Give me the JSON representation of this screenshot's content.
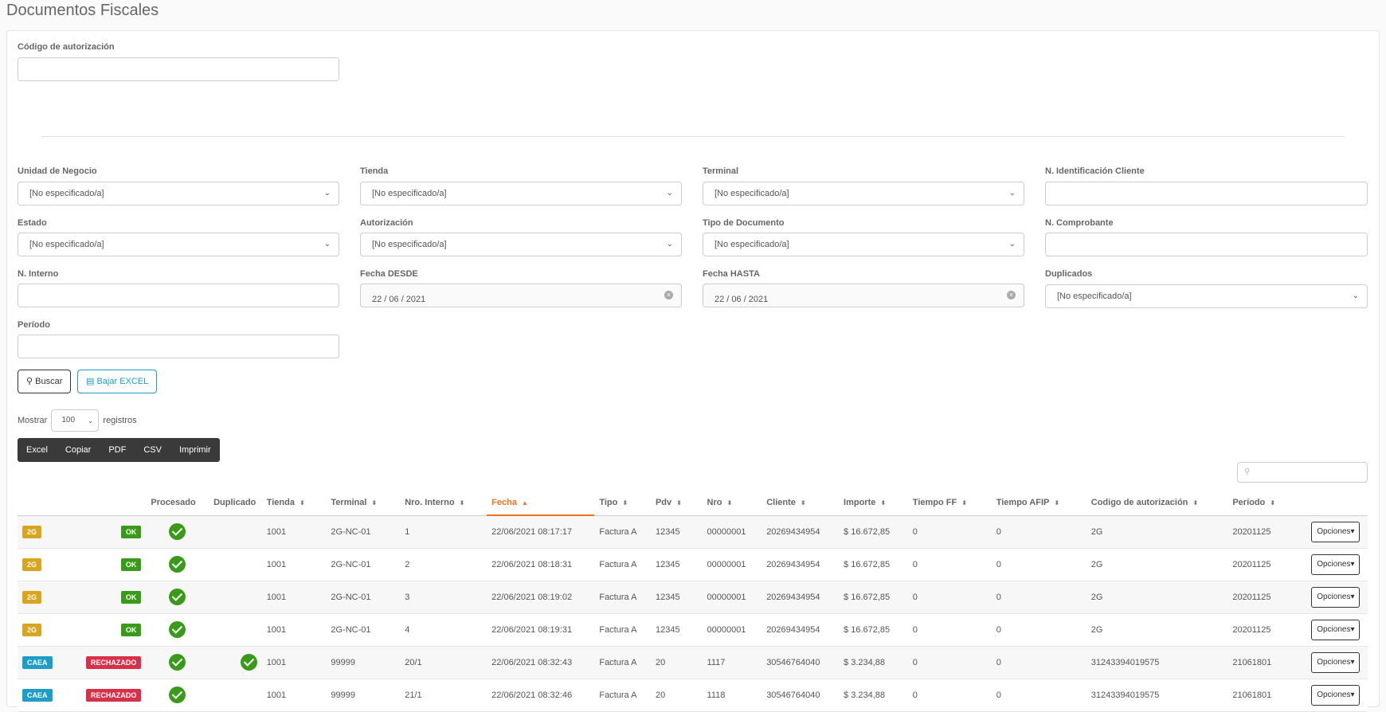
{
  "page": {
    "title": "Documentos Fiscales"
  },
  "filters": {
    "auth_code": {
      "label": "Código de autorización",
      "value": ""
    },
    "unidad": {
      "label": "Unidad de Negocio",
      "value": "[No especificado/a]"
    },
    "tienda": {
      "label": "Tienda",
      "value": "[No especificado/a]"
    },
    "terminal": {
      "label": "Terminal",
      "value": "[No especificado/a]"
    },
    "n_ident_cliente": {
      "label": "N. Identificación Cliente",
      "value": ""
    },
    "estado": {
      "label": "Estado",
      "value": "[No especificado/a]"
    },
    "autorizacion": {
      "label": "Autorización",
      "value": "[No especificado/a]"
    },
    "tipo_doc": {
      "label": "Tipo de Documento",
      "value": "[No especificado/a]"
    },
    "n_comprobante": {
      "label": "N. Comprobante",
      "value": ""
    },
    "n_interno": {
      "label": "N. Interno",
      "value": ""
    },
    "fecha_desde": {
      "label": "Fecha DESDE",
      "value": "22 / 06 / 2021"
    },
    "fecha_hasta": {
      "label": "Fecha HASTA",
      "value": "22 / 06 / 2021"
    },
    "duplicados": {
      "label": "Duplicados",
      "value": "[No especificado/a]"
    },
    "periodo": {
      "label": "Período",
      "value": ""
    }
  },
  "actions": {
    "search": "Buscar",
    "excel": "Bajar EXCEL"
  },
  "length_menu": {
    "prefix": "Mostrar",
    "value": "100",
    "suffix": "registros"
  },
  "export_buttons": [
    "Excel",
    "Copiar",
    "PDF",
    "CSV",
    "Imprimir"
  ],
  "colors": {
    "badge_2g": "#d9a520",
    "badge_caea": "#1e9dc8",
    "badge_ok": "#3a9a1a",
    "badge_rech": "#d9304a",
    "accent": "#f0711c"
  },
  "table": {
    "headers": [
      "",
      "",
      "Procesado",
      "Duplicado",
      "Tienda",
      "Terminal",
      "Nro. Interno",
      "Fecha",
      "Tipo",
      "Pdv",
      "Nro",
      "Cliente",
      "Importe",
      "Tiempo FF",
      "Tiempo AFIP",
      "Codigo de autorización",
      "Período",
      ""
    ],
    "options_label": "Opciones",
    "rows": [
      {
        "type": "2G",
        "status": "OK",
        "procesado": true,
        "duplicado": false,
        "tienda": "1001",
        "terminal": "2G-NC-01",
        "interno": "1",
        "fecha": "22/06/2021 08:17:17",
        "tipo": "Factura A",
        "pdv": "12345",
        "nro": "00000001",
        "cliente": "20269434954",
        "importe": "$ 16.672,85",
        "tff": "0",
        "tafip": "0",
        "codigo": "2G",
        "periodo": "20201125"
      },
      {
        "type": "2G",
        "status": "OK",
        "procesado": true,
        "duplicado": false,
        "tienda": "1001",
        "terminal": "2G-NC-01",
        "interno": "2",
        "fecha": "22/06/2021 08:18:31",
        "tipo": "Factura A",
        "pdv": "12345",
        "nro": "00000001",
        "cliente": "20269434954",
        "importe": "$ 16.672,85",
        "tff": "0",
        "tafip": "0",
        "codigo": "2G",
        "periodo": "20201125"
      },
      {
        "type": "2G",
        "status": "OK",
        "procesado": true,
        "duplicado": false,
        "tienda": "1001",
        "terminal": "2G-NC-01",
        "interno": "3",
        "fecha": "22/06/2021 08:19:02",
        "tipo": "Factura A",
        "pdv": "12345",
        "nro": "00000001",
        "cliente": "20269434954",
        "importe": "$ 16.672,85",
        "tff": "0",
        "tafip": "0",
        "codigo": "2G",
        "periodo": "20201125"
      },
      {
        "type": "2G",
        "status": "OK",
        "procesado": true,
        "duplicado": false,
        "tienda": "1001",
        "terminal": "2G-NC-01",
        "interno": "4",
        "fecha": "22/06/2021 08:19:31",
        "tipo": "Factura A",
        "pdv": "12345",
        "nro": "00000001",
        "cliente": "20269434954",
        "importe": "$ 16.672,85",
        "tff": "0",
        "tafip": "0",
        "codigo": "2G",
        "periodo": "20201125"
      },
      {
        "type": "CAEA",
        "status": "RECHAZADO",
        "procesado": true,
        "duplicado": true,
        "tienda": "1001",
        "terminal": "99999",
        "interno": "20/1",
        "fecha": "22/06/2021 08:32:43",
        "tipo": "Factura A",
        "pdv": "20",
        "nro": "1117",
        "cliente": "30546764040",
        "importe": "$ 3.234,88",
        "tff": "0",
        "tafip": "0",
        "codigo": "31243394019575",
        "periodo": "21061801"
      },
      {
        "type": "CAEA",
        "status": "RECHAZADO",
        "procesado": true,
        "duplicado": false,
        "tienda": "1001",
        "terminal": "99999",
        "interno": "21/1",
        "fecha": "22/06/2021 08:32:46",
        "tipo": "Factura A",
        "pdv": "20",
        "nro": "1118",
        "cliente": "30546764040",
        "importe": "$ 3.234,88",
        "tff": "0",
        "tafip": "0",
        "codigo": "31243394019575",
        "periodo": "21061801"
      }
    ]
  }
}
